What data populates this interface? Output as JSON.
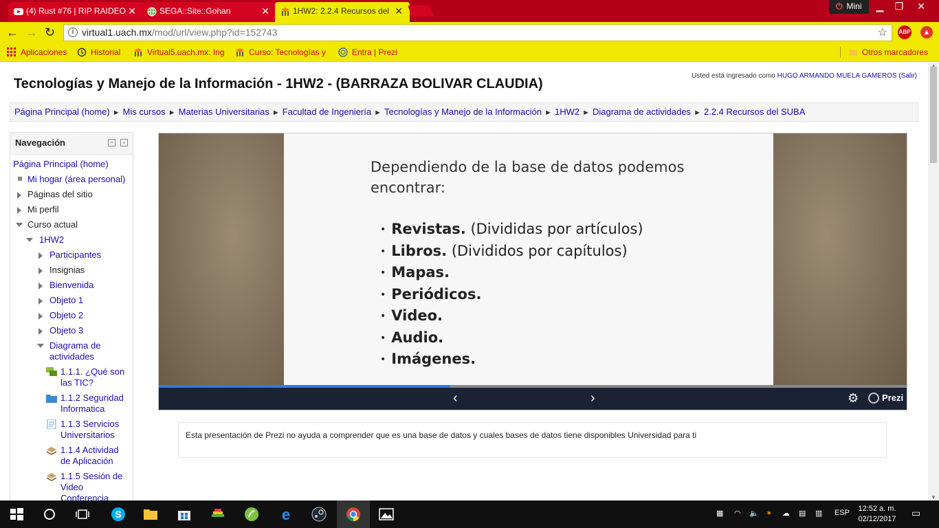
{
  "browser": {
    "tabs": [
      {
        "label": "(4) Rust #76 | RIP RAIDEO",
        "active": false
      },
      {
        "label": "SEGA::Site::Gohan",
        "active": false
      },
      {
        "label": "1HW2: 2.2.4 Recursos del",
        "active": true
      }
    ],
    "mini_label": "Mini",
    "url_host": "virtual1.uach.mx",
    "url_path": "/mod/url/view.php?id=152743",
    "bookmarks": [
      {
        "label": "Aplicaciones"
      },
      {
        "label": "Historial"
      },
      {
        "label": "Virtual5.uach.mx: Ing"
      },
      {
        "label": "Curso: Tecnologías y"
      },
      {
        "label": "Entra | Prezi"
      }
    ],
    "other_bookmarks": "Otros marcadores",
    "abp": "ABP"
  },
  "page": {
    "login_prefix": "Usted está ingresado como",
    "login_user": "HUGO ARMANDO MUELA GAMEROS",
    "logout": "(Salir)",
    "course_title": "Tecnologías y Manejo de la Información - 1HW2 - (BARRAZA BOLIVAR CLAUDIA)",
    "breadcrumb": [
      "Página Principal (home)",
      "Mis cursos",
      "Materias Universitarias",
      "Facultad de Ingeniería",
      "Tecnologías y Manejo de la Información",
      "1HW2",
      "Diagrama de actividades",
      "2.2.4 Recursos del SUBA"
    ],
    "breadcrumb_sep": "►"
  },
  "navigation": {
    "title": "Navegación",
    "items": {
      "home": "Página Principal (home)",
      "mi_hogar": "Mi hogar (área personal)",
      "paginas": "Páginas del sitio",
      "perfil": "Mi perfil",
      "curso_actual": "Curso actual",
      "hw2": "1HW2",
      "participantes": "Participantes",
      "insignias": "Insignias",
      "bienvenida": "Bienvenida",
      "objeto1": "Objeto 1",
      "objeto2": "Objeto 2",
      "objeto3": "Objeto 3",
      "diagrama_1": "Diagrama de",
      "diagrama_2": "actividades",
      "a111_1": "1.1.1. ¿Qué son",
      "a111_2": "las TIC?",
      "a112_1": "1.1.2 Seguridad",
      "a112_2": "Informatica",
      "a113_1": "1.1.3 Servicios",
      "a113_2": "Universitarios",
      "a114_1": "1.1.4 Actividad",
      "a114_2": "de Aplicación",
      "a115_1": "1.1.5 Sesión de",
      "a115_2": "Video",
      "a115_3": "Conferencia"
    }
  },
  "prezi": {
    "intro": "Dependiendo de la base de datos podemos encontrar:",
    "bullets": [
      {
        "bold": "Revistas.",
        "rest": " (Divididas por artículos)"
      },
      {
        "bold": "Libros.",
        "rest": " (Divididos por capítulos)"
      },
      {
        "bold": "Mapas.",
        "rest": ""
      },
      {
        "bold": "Periódicos.",
        "rest": ""
      },
      {
        "bold": "Video.",
        "rest": ""
      },
      {
        "bold": "Audio.",
        "rest": ""
      },
      {
        "bold": "Imágenes.",
        "rest": ""
      }
    ],
    "progress": 0.39,
    "logo": "Prezi"
  },
  "description": "Esta presentación de Prezi no ayuda a comprender que es una base de datos y cuales bases de datos tiene disponibles Universidad para ti",
  "taskbar": {
    "lang": "ESP",
    "time": "12:52 a. m.",
    "date": "02/12/2017"
  }
}
